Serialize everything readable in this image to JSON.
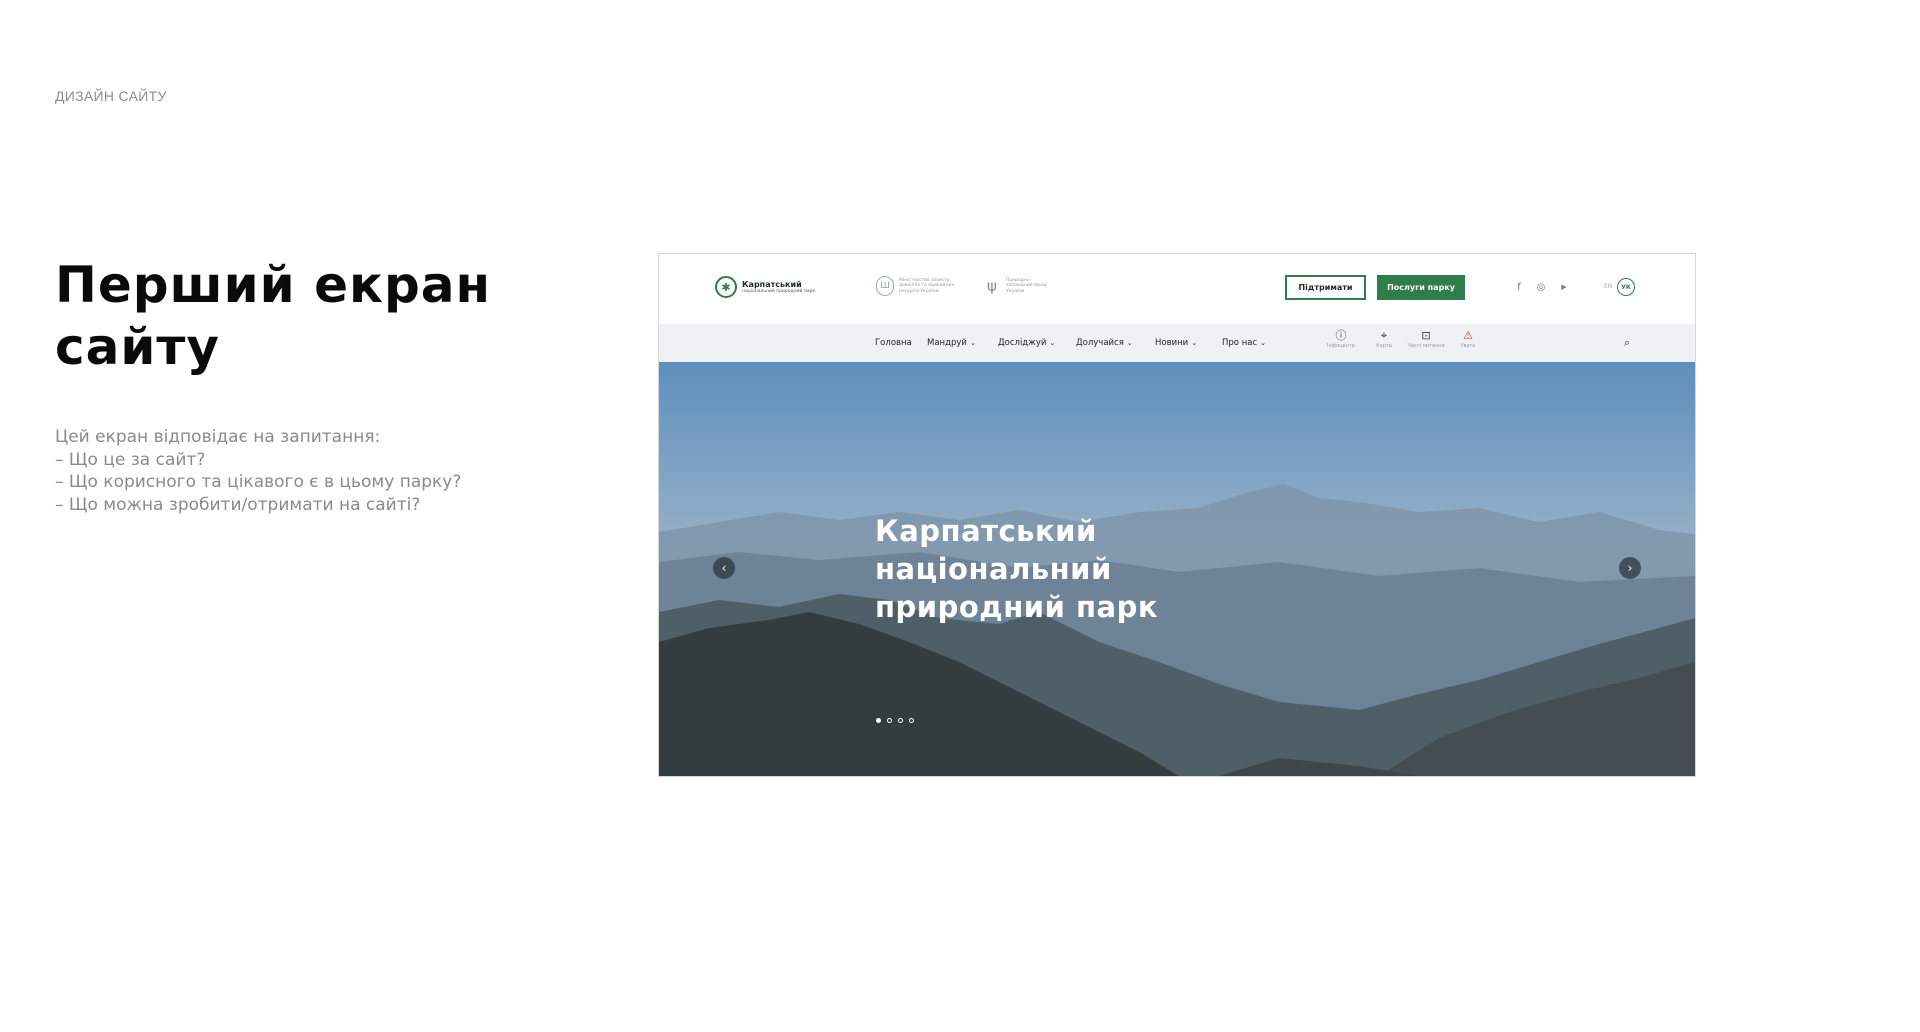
{
  "eyebrow": "ДИЗАЙН САЙТУ",
  "title_lines": [
    "Перший екран",
    "сайту"
  ],
  "description": [
    "Цей екран відповідає на запитання:",
    "– Що це за сайт?",
    "– Що корисного та цікавого є в цьому парку?",
    "– Що можна зробити/отримати на сайті?"
  ],
  "mockup": {
    "logo": {
      "name": "Карпатський",
      "subtitle": "національний природний парк"
    },
    "partners": [
      {
        "icon": "coat-of-arms-icon",
        "text": "Міністерство захисту довкілля та природних ресурсів України"
      },
      {
        "icon": "trident-icon",
        "text": "Природно-заповідний фонд України"
      }
    ],
    "buttons": {
      "support": "Підтримати",
      "services": "Послуги парку"
    },
    "social": [
      {
        "icon": "facebook-icon",
        "glyph": "f"
      },
      {
        "icon": "instagram-icon",
        "glyph": "◎"
      },
      {
        "icon": "youtube-icon",
        "glyph": "▶"
      }
    ],
    "lang": {
      "en": "EN",
      "uk": "УК"
    },
    "nav": [
      {
        "label": "Головна",
        "dropdown": false
      },
      {
        "label": "Мандруй",
        "dropdown": true
      },
      {
        "label": "Досліджуй",
        "dropdown": true
      },
      {
        "label": "Долучайся",
        "dropdown": true
      },
      {
        "label": "Новини",
        "dropdown": true
      },
      {
        "label": "Про нас",
        "dropdown": true
      }
    ],
    "quick_links": [
      {
        "icon": "info-icon",
        "glyph": "ⓘ",
        "label": "Інфоцентр"
      },
      {
        "icon": "map-icon",
        "glyph": "⌖",
        "label": "Карта"
      },
      {
        "icon": "faq-icon",
        "glyph": "⊡",
        "label": "Часті питання"
      },
      {
        "icon": "warning-icon",
        "glyph": "⚠",
        "label": "Увага"
      }
    ],
    "hero": {
      "title_lines": [
        "Карпатський",
        "національний",
        "природний парк"
      ],
      "slides": 4,
      "active_slide": 1
    },
    "colors": {
      "brand_green": "#2f7d4a",
      "nav_bg": "#eef2f4"
    }
  }
}
